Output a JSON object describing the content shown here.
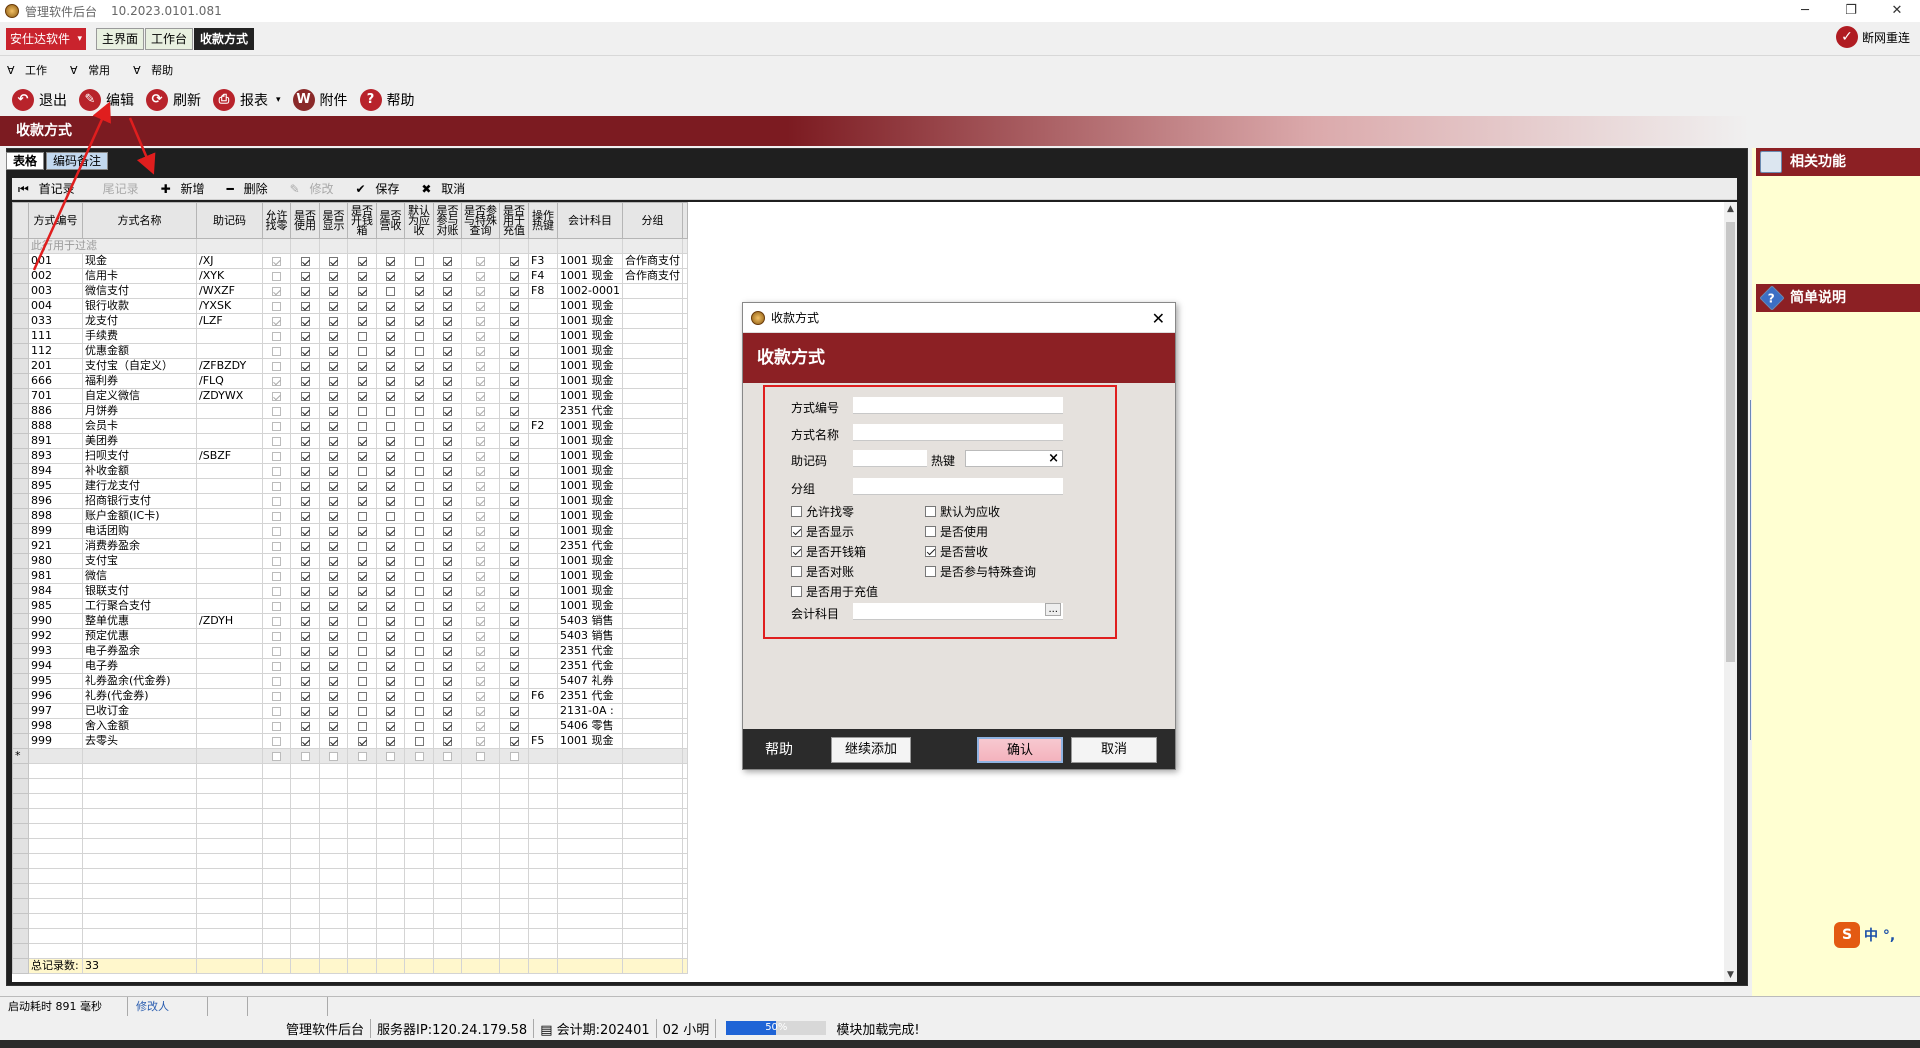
{
  "window": {
    "title": "管理软件后台",
    "version": "10.2023.0101.081",
    "minimize": "─",
    "restore": "❐",
    "close": "✕"
  },
  "topbar": {
    "brand": "安仕达软件",
    "tabs": [
      "主界面",
      "工作台",
      "收款方式"
    ],
    "reconnect": "断网重连"
  },
  "menu": [
    "工作",
    "常用",
    "帮助"
  ],
  "toolbar": {
    "exit": "退出",
    "edit": "编辑",
    "refresh": "刷新",
    "report": "报表",
    "attach": "附件",
    "help": "帮助"
  },
  "banner_title": "收款方式",
  "subtabs": [
    "表格",
    "编码备注"
  ],
  "gridbar": {
    "first": "首记录",
    "last": "尾记录",
    "add": "新增",
    "del": "删除",
    "modify": "修改",
    "save": "保存",
    "cancel": "取消"
  },
  "columns": [
    "方式编号",
    "方式名称",
    "助记码",
    "允许找零",
    "是否使用",
    "是否显示",
    "是否开钱箱",
    "是否营收",
    "默认为应收",
    "是否参与对账",
    "是否参与特殊查询",
    "是否用于充值",
    "操作热键",
    "会计科目",
    "分组"
  ],
  "filter_text": "此行用于过滤",
  "rows": [
    {
      "code": "001",
      "name": "现金",
      "memo": "/XJ",
      "flags": [
        1,
        1,
        1,
        1,
        1,
        0,
        1,
        1,
        1
      ],
      "key": "F3",
      "acct": "1001  现金",
      "group": "合作商支付"
    },
    {
      "code": "002",
      "name": "信用卡",
      "memo": "/XYK",
      "flags": [
        0,
        1,
        1,
        1,
        1,
        1,
        1,
        1,
        1
      ],
      "key": "F4",
      "acct": "1001  现金",
      "group": "合作商支付"
    },
    {
      "code": "003",
      "name": "微信支付",
      "memo": "/WXZF",
      "flags": [
        1,
        1,
        1,
        1,
        0,
        1,
        1,
        1,
        1
      ],
      "key": "F8",
      "acct": "1002-0001",
      "group": ""
    },
    {
      "code": "004",
      "name": "银行收款",
      "memo": "/YXSK",
      "flags": [
        0,
        1,
        1,
        1,
        1,
        1,
        1,
        1,
        1
      ],
      "key": "",
      "acct": "1001  现金",
      "group": ""
    },
    {
      "code": "033",
      "name": "龙支付",
      "memo": "/LZF",
      "flags": [
        1,
        1,
        1,
        1,
        1,
        1,
        1,
        1,
        1
      ],
      "key": "",
      "acct": "1001  现金",
      "group": ""
    },
    {
      "code": "111",
      "name": "手续费",
      "memo": "",
      "flags": [
        0,
        1,
        1,
        0,
        1,
        0,
        1,
        1,
        1
      ],
      "key": "",
      "acct": "1001  现金",
      "group": ""
    },
    {
      "code": "112",
      "name": "优惠金额",
      "memo": "",
      "flags": [
        0,
        1,
        1,
        0,
        1,
        0,
        1,
        1,
        1
      ],
      "key": "",
      "acct": "1001  现金",
      "group": ""
    },
    {
      "code": "201",
      "name": "支付宝（自定义）",
      "memo": "/ZFBZDY",
      "flags": [
        0,
        1,
        1,
        1,
        1,
        1,
        1,
        1,
        1
      ],
      "key": "",
      "acct": "1001  现金",
      "group": ""
    },
    {
      "code": "666",
      "name": "福利券",
      "memo": "/FLQ",
      "flags": [
        1,
        1,
        1,
        1,
        1,
        1,
        1,
        1,
        1
      ],
      "key": "",
      "acct": "1001  现金",
      "group": ""
    },
    {
      "code": "701",
      "name": "自定义微信",
      "memo": "/ZDYWX",
      "flags": [
        1,
        1,
        1,
        1,
        1,
        1,
        1,
        1,
        1
      ],
      "key": "",
      "acct": "1001  现金",
      "group": ""
    },
    {
      "code": "886",
      "name": "月饼券",
      "memo": "",
      "flags": [
        0,
        1,
        1,
        0,
        0,
        0,
        1,
        1,
        1
      ],
      "key": "",
      "acct": "2351  代金",
      "group": ""
    },
    {
      "code": "888",
      "name": "会员卡",
      "memo": "",
      "flags": [
        0,
        1,
        1,
        0,
        0,
        0,
        1,
        1,
        1
      ],
      "key": "F2",
      "acct": "1001  现金",
      "group": ""
    },
    {
      "code": "891",
      "name": "美团券",
      "memo": "",
      "flags": [
        0,
        1,
        1,
        1,
        1,
        0,
        1,
        1,
        1
      ],
      "key": "",
      "acct": "1001  现金",
      "group": ""
    },
    {
      "code": "893",
      "name": "扫呗支付",
      "memo": "/SBZF",
      "flags": [
        0,
        1,
        1,
        1,
        1,
        0,
        1,
        1,
        1
      ],
      "key": "",
      "acct": "1001  现金",
      "group": ""
    },
    {
      "code": "894",
      "name": "补收金额",
      "memo": "",
      "flags": [
        0,
        1,
        1,
        0,
        1,
        0,
        1,
        1,
        1
      ],
      "key": "",
      "acct": "1001  现金",
      "group": ""
    },
    {
      "code": "895",
      "name": "建行龙支付",
      "memo": "",
      "flags": [
        0,
        1,
        1,
        1,
        1,
        0,
        1,
        1,
        1
      ],
      "key": "",
      "acct": "1001  现金",
      "group": ""
    },
    {
      "code": "896",
      "name": "招商银行支付",
      "memo": "",
      "flags": [
        0,
        1,
        1,
        1,
        1,
        0,
        1,
        1,
        1
      ],
      "key": "",
      "acct": "1001  现金",
      "group": ""
    },
    {
      "code": "898",
      "name": "账户金额(IC卡)",
      "memo": "",
      "flags": [
        0,
        1,
        1,
        0,
        0,
        0,
        1,
        1,
        1
      ],
      "key": "",
      "acct": "1001  现金",
      "group": ""
    },
    {
      "code": "899",
      "name": "电话团购",
      "memo": "",
      "flags": [
        0,
        1,
        1,
        1,
        1,
        0,
        1,
        1,
        1
      ],
      "key": "",
      "acct": "1001  现金",
      "group": ""
    },
    {
      "code": "921",
      "name": "消费券盈余",
      "memo": "",
      "flags": [
        0,
        1,
        1,
        0,
        1,
        0,
        1,
        1,
        1
      ],
      "key": "",
      "acct": "2351  代金",
      "group": ""
    },
    {
      "code": "980",
      "name": "支付宝",
      "memo": "",
      "flags": [
        0,
        1,
        1,
        1,
        1,
        0,
        1,
        1,
        1
      ],
      "key": "",
      "acct": "1001  现金",
      "group": ""
    },
    {
      "code": "981",
      "name": "微信",
      "memo": "",
      "flags": [
        0,
        1,
        1,
        1,
        1,
        0,
        1,
        1,
        1
      ],
      "key": "",
      "acct": "1001  现金",
      "group": ""
    },
    {
      "code": "984",
      "name": "银联支付",
      "memo": "",
      "flags": [
        0,
        1,
        1,
        1,
        1,
        0,
        1,
        1,
        1
      ],
      "key": "",
      "acct": "1001  现金",
      "group": ""
    },
    {
      "code": "985",
      "name": "工行聚合支付",
      "memo": "",
      "flags": [
        0,
        1,
        1,
        1,
        1,
        0,
        1,
        1,
        1
      ],
      "key": "",
      "acct": "1001  现金",
      "group": ""
    },
    {
      "code": "990",
      "name": "整单优惠",
      "memo": "/ZDYH",
      "flags": [
        0,
        1,
        1,
        0,
        1,
        0,
        1,
        1,
        1
      ],
      "key": "",
      "acct": "5403  销售",
      "group": ""
    },
    {
      "code": "992",
      "name": "预定优惠",
      "memo": "",
      "flags": [
        0,
        1,
        1,
        0,
        1,
        0,
        1,
        1,
        1
      ],
      "key": "",
      "acct": "5403  销售",
      "group": ""
    },
    {
      "code": "993",
      "name": "电子券盈余",
      "memo": "",
      "flags": [
        0,
        1,
        1,
        0,
        1,
        0,
        1,
        1,
        1
      ],
      "key": "",
      "acct": "2351  代金",
      "group": ""
    },
    {
      "code": "994",
      "name": "电子券",
      "memo": "",
      "flags": [
        0,
        1,
        1,
        0,
        1,
        0,
        1,
        1,
        1
      ],
      "key": "",
      "acct": "2351  代金",
      "group": ""
    },
    {
      "code": "995",
      "name": "礼券盈余(代金券)",
      "memo": "",
      "flags": [
        0,
        1,
        1,
        0,
        1,
        0,
        1,
        1,
        1
      ],
      "key": "",
      "acct": "5407  礼券",
      "group": ""
    },
    {
      "code": "996",
      "name": "礼券(代金券)",
      "memo": "",
      "flags": [
        0,
        1,
        1,
        0,
        1,
        0,
        1,
        1,
        1
      ],
      "key": "F6",
      "acct": "2351  代金",
      "group": ""
    },
    {
      "code": "997",
      "name": "已收订金",
      "memo": "",
      "flags": [
        0,
        1,
        1,
        0,
        1,
        0,
        1,
        1,
        1
      ],
      "key": "",
      "acct": "2131-0A  :",
      "group": ""
    },
    {
      "code": "998",
      "name": "舍入金额",
      "memo": "",
      "flags": [
        0,
        1,
        1,
        0,
        1,
        0,
        1,
        1,
        1
      ],
      "key": "",
      "acct": "5406  零售",
      "group": ""
    },
    {
      "code": "999",
      "name": "去零头",
      "memo": "",
      "flags": [
        0,
        1,
        1,
        1,
        1,
        0,
        1,
        1,
        1
      ],
      "key": "F5",
      "acct": "1001  现金",
      "group": ""
    }
  ],
  "new_row_marker": "*",
  "footer": {
    "label": "总记录数:",
    "count": "33"
  },
  "rightpanel": {
    "related": "相关功能",
    "brief": "简单说明"
  },
  "ime": {
    "logo": "S",
    "text": "中 °,"
  },
  "statusbar": {
    "startup": "启动耗时 891 毫秒",
    "modifier": "修改人"
  },
  "infobar": {
    "appname": "管理软件后台",
    "server": "服务器IP:120.24.179.58",
    "period": "会计期:202401",
    "user": "02 小明",
    "progress_text": "50%",
    "progress": 0.5,
    "message": "模块加载完成!"
  },
  "dialog": {
    "title": "收款方式",
    "banner": "收款方式",
    "code_label": "方式编号",
    "name_label": "方式名称",
    "memo_label": "助记码",
    "hotkey_label": "热键",
    "clear": "×",
    "group_label": "分组",
    "acct_label": "会计科目",
    "browse": "...",
    "checks": {
      "allow_change": {
        "label": "允许找零",
        "checked": false
      },
      "default_receivable": {
        "label": "默认为应收",
        "checked": false
      },
      "show": {
        "label": "是否显示",
        "checked": true
      },
      "use": {
        "label": "是否使用",
        "checked": false
      },
      "cashbox": {
        "label": "是否开钱箱",
        "checked": true
      },
      "revenue": {
        "label": "是否营收",
        "checked": true
      },
      "reconcile": {
        "label": "是否对账",
        "checked": false
      },
      "special_query": {
        "label": "是否参与特殊查询",
        "checked": false
      },
      "recharge": {
        "label": "是否用于充值",
        "checked": false
      }
    },
    "help": "帮助",
    "continue_add": "继续添加",
    "confirm": "确认",
    "cancel": "取消"
  }
}
